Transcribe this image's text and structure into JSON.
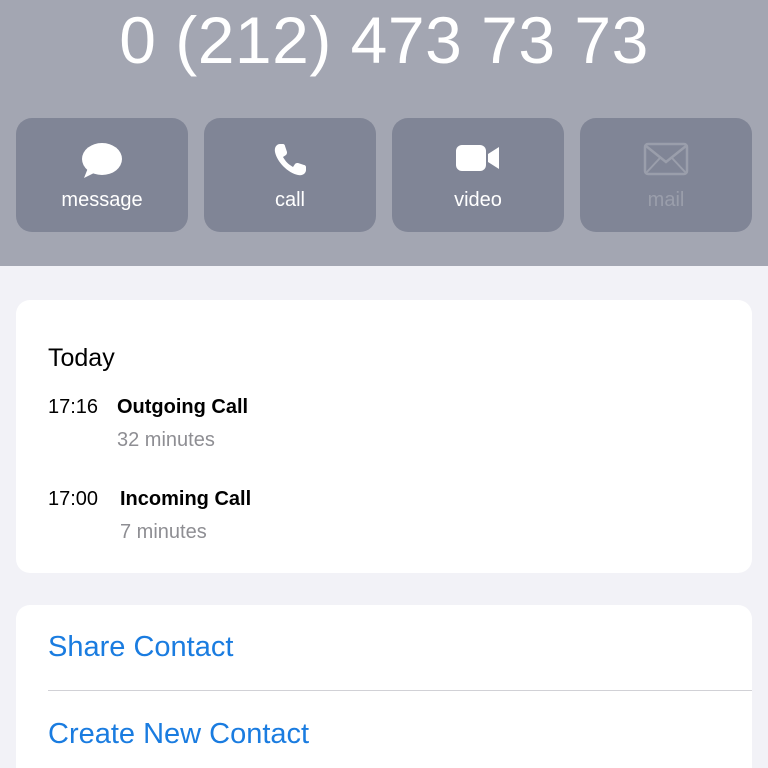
{
  "header": {
    "phone_number": "0 (212) 473 73 73",
    "background": "#a3a6b2",
    "actions": [
      {
        "label": "message",
        "icon": "message-bubble-icon",
        "enabled": true
      },
      {
        "label": "call",
        "icon": "phone-icon",
        "enabled": true
      },
      {
        "label": "video",
        "icon": "video-camera-icon",
        "enabled": true
      },
      {
        "label": "mail",
        "icon": "envelope-icon",
        "enabled": false
      }
    ]
  },
  "history": {
    "day": "Today",
    "calls": [
      {
        "time": "17:16",
        "type": "Outgoing Call",
        "duration": "32 minutes"
      },
      {
        "time": "17:00",
        "type": "Incoming Call",
        "duration": "7 minutes"
      }
    ]
  },
  "options": {
    "share_contact": "Share Contact",
    "create_new_contact": "Create New Contact",
    "link_color": "#1a7ce0"
  }
}
